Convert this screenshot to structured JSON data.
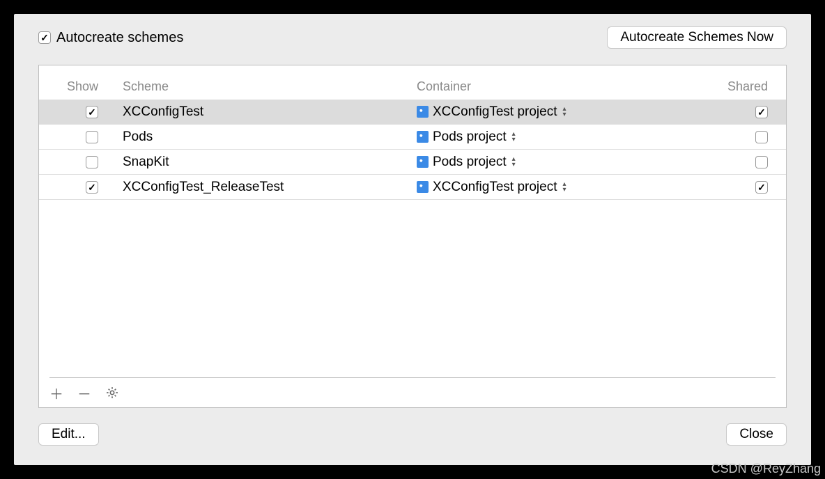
{
  "top": {
    "autocreate_label": "Autocreate schemes",
    "autocreate_checked": true,
    "autocreate_now_btn": "Autocreate Schemes Now"
  },
  "columns": {
    "show": "Show",
    "scheme": "Scheme",
    "container": "Container",
    "shared": "Shared"
  },
  "rows": [
    {
      "show": true,
      "scheme": "XCConfigTest",
      "container": "XCConfigTest project",
      "shared": true,
      "selected": true
    },
    {
      "show": false,
      "scheme": "Pods",
      "container": "Pods project",
      "shared": false,
      "selected": false
    },
    {
      "show": false,
      "scheme": "SnapKit",
      "container": "Pods project",
      "shared": false,
      "selected": false
    },
    {
      "show": true,
      "scheme": "XCConfigTest_ReleaseTest",
      "container": "XCConfigTest project",
      "shared": true,
      "selected": false
    }
  ],
  "footer": {
    "edit": "Edit...",
    "close": "Close"
  },
  "watermark": "CSDN @ReyZhang"
}
